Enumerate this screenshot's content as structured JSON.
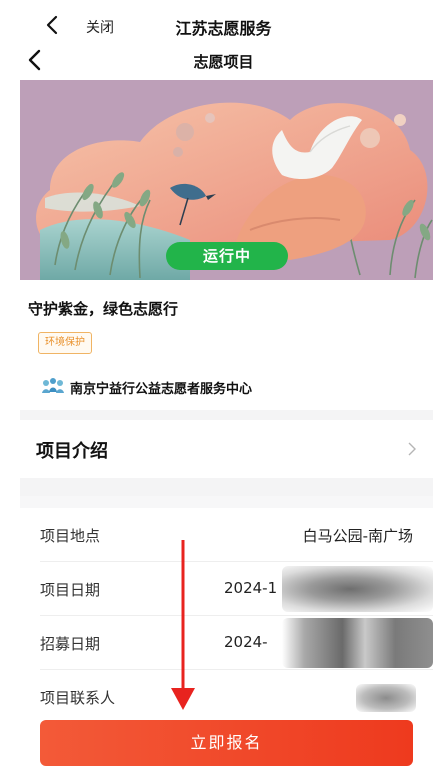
{
  "topbar": {
    "close_label": "关闭",
    "app_title": "江苏志愿服务"
  },
  "navbar": {
    "page_title": "志愿项目"
  },
  "banner": {
    "status": "运行中"
  },
  "project": {
    "name": "守护紫金，绿色志愿行",
    "tag": "环境保护",
    "organization": "南京宁益行公益志愿者服务中心"
  },
  "intro": {
    "title": "项目介绍"
  },
  "details": {
    "location": {
      "label": "项目地点",
      "value": "白马公园-南广场"
    },
    "date": {
      "label": "项目日期",
      "value": "2024-1"
    },
    "recruit": {
      "label": "招募日期",
      "value": "2024-"
    },
    "contact": {
      "label": "项目联系人"
    }
  },
  "signup_label": "立即报名",
  "colors": {
    "status_green": "#22b44a",
    "signup_red": "#ee3a1e",
    "tag_orange": "#e9902a",
    "annotation_red": "#e8231f"
  }
}
